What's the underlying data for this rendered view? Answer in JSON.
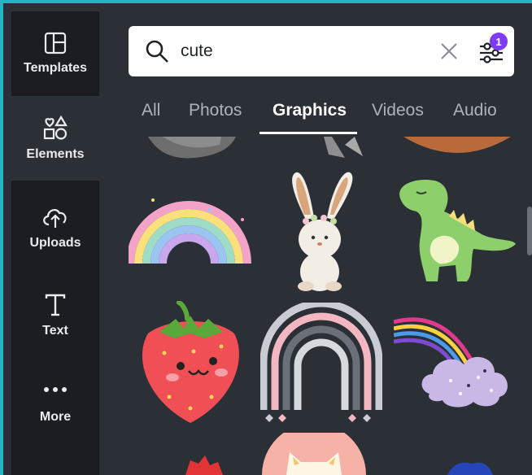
{
  "sidebar": {
    "items": [
      {
        "label": "Templates",
        "icon": "templates-icon"
      },
      {
        "label": "Elements",
        "icon": "elements-icon"
      },
      {
        "label": "Uploads",
        "icon": "uploads-icon"
      },
      {
        "label": "Text",
        "icon": "text-icon"
      },
      {
        "label": "More",
        "icon": "more-icon"
      }
    ],
    "active": "Elements"
  },
  "search": {
    "value": "cute",
    "filter_badge": "1"
  },
  "tabs": [
    "All",
    "Photos",
    "Graphics",
    "Videos",
    "Audio"
  ],
  "active_tab": "Graphics",
  "graphics": [
    {
      "name": "partial-graphic-1"
    },
    {
      "name": "partial-graphic-2"
    },
    {
      "name": "partial-graphic-3"
    },
    {
      "name": "rainbow-graphic"
    },
    {
      "name": "bunny-graphic"
    },
    {
      "name": "dinosaur-graphic"
    },
    {
      "name": "strawberry-graphic"
    },
    {
      "name": "boho-rainbow-graphic"
    },
    {
      "name": "rainbow-cloud-graphic"
    },
    {
      "name": "red-graphic-partial"
    },
    {
      "name": "cat-graphic-partial"
    },
    {
      "name": "blue-graphic-partial"
    }
  ],
  "colors": {
    "accent_border": "#22b5c4",
    "panel_bg": "#2b2f36",
    "sidebar_bg": "#1b1d22",
    "badge": "#7d3cf0"
  }
}
